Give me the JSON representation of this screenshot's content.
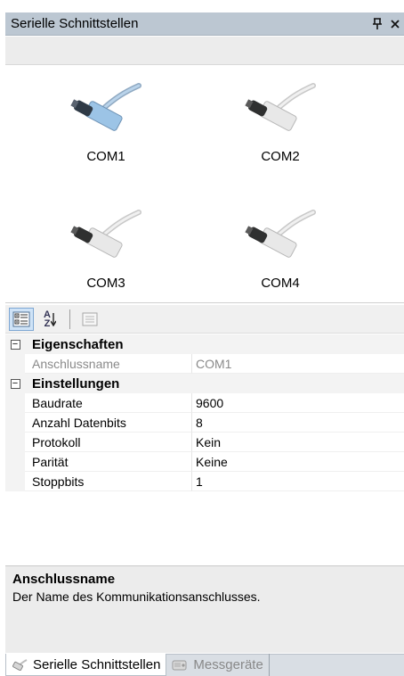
{
  "panel": {
    "title": "Serielle Schnittstellen",
    "pin_glyph": "\u0004",
    "close_glyph": "×"
  },
  "ports": [
    {
      "label": "COM1",
      "selected": true,
      "color": "#9cc4e6"
    },
    {
      "label": "COM2",
      "selected": false,
      "color": "#e8e8e8"
    },
    {
      "label": "COM3",
      "selected": false,
      "color": "#e8e8e8"
    },
    {
      "label": "COM4",
      "selected": false,
      "color": "#e8e8e8"
    }
  ],
  "toolbar": {
    "sort_az_top": "A",
    "sort_az_bottom": "Z"
  },
  "properties": {
    "cat1": {
      "label": "Eigenschaften",
      "expander": "−",
      "items": [
        {
          "name": "Anschlussname",
          "value": "COM1"
        }
      ]
    },
    "cat2": {
      "label": "Einstellungen",
      "expander": "−",
      "items": [
        {
          "name": "Baudrate",
          "value": "9600"
        },
        {
          "name": "Anzahl Datenbits",
          "value": "8"
        },
        {
          "name": "Protokoll",
          "value": "Kein"
        },
        {
          "name": "Parität",
          "value": "Keine"
        },
        {
          "name": "Stoppbits",
          "value": "1"
        }
      ]
    }
  },
  "description": {
    "title": "Anschlussname",
    "text": "Der Name des Kommunikationsanschlusses."
  },
  "tabs": [
    {
      "label": "Serielle Schnittstellen",
      "active": true
    },
    {
      "label": "Messgeräte",
      "active": false
    }
  ],
  "colors": {
    "title_bar": "#bcc7d2",
    "selected_port": "#9cc4e6",
    "category_bg": "#f3f3f3"
  }
}
